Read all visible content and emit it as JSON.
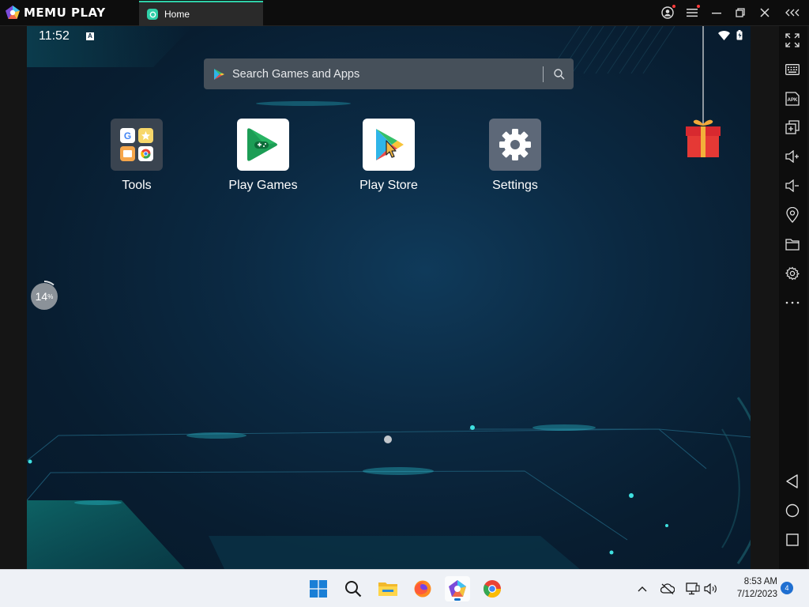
{
  "window": {
    "app_name": "MEMU PLAY",
    "tab_label": "Home"
  },
  "status_bar": {
    "time": "11:52",
    "indicator": "A"
  },
  "search": {
    "placeholder": "Search Games and Apps"
  },
  "apps": [
    {
      "label": "Tools",
      "icon": "tools-folder-icon"
    },
    {
      "label": "Play Games",
      "icon": "play-games-icon"
    },
    {
      "label": "Play Store",
      "icon": "play-store-icon"
    },
    {
      "label": "Settings",
      "icon": "settings-gear-icon"
    }
  ],
  "progress_badge": {
    "value": "14",
    "unit": "%"
  },
  "sidebar_tools": [
    "fullscreen-icon",
    "keyboard-icon",
    "apk-icon",
    "multi-instance-icon",
    "volume-up-icon",
    "volume-down-icon",
    "location-icon",
    "folder-icon",
    "settings-icon",
    "more-icon"
  ],
  "sidebar_nav": [
    "back-icon",
    "home-icon",
    "recents-icon"
  ],
  "taskbar": {
    "apps": [
      "windows-start-icon",
      "search-icon",
      "file-explorer-icon",
      "firefox-icon",
      "memu-icon",
      "chrome-icon"
    ],
    "time": "8:53 AM",
    "date": "7/12/2023",
    "notification_count": "4"
  },
  "colors": {
    "accent": "#2fd0a8",
    "screen_bg": "#0b2942",
    "taskbar_bg": "#eef1f6"
  }
}
